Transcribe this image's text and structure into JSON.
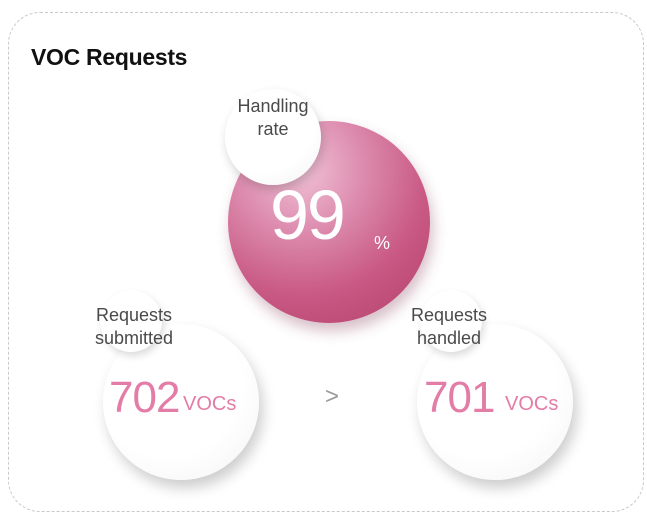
{
  "title": "VOC Requests",
  "handling": {
    "label_line1": "Handling",
    "label_line2": "rate",
    "value": "99",
    "unit": "%"
  },
  "submitted": {
    "label_line1": "Requests",
    "label_line2": "submitted",
    "value": "702",
    "unit": "VOCs"
  },
  "comparison": ">",
  "handled": {
    "label_line1": "Requests",
    "label_line2": "handled",
    "value": "701",
    "unit": "VOCs"
  },
  "colors": {
    "accent": "#e37ca6",
    "rate_circle": "#c95a85"
  }
}
